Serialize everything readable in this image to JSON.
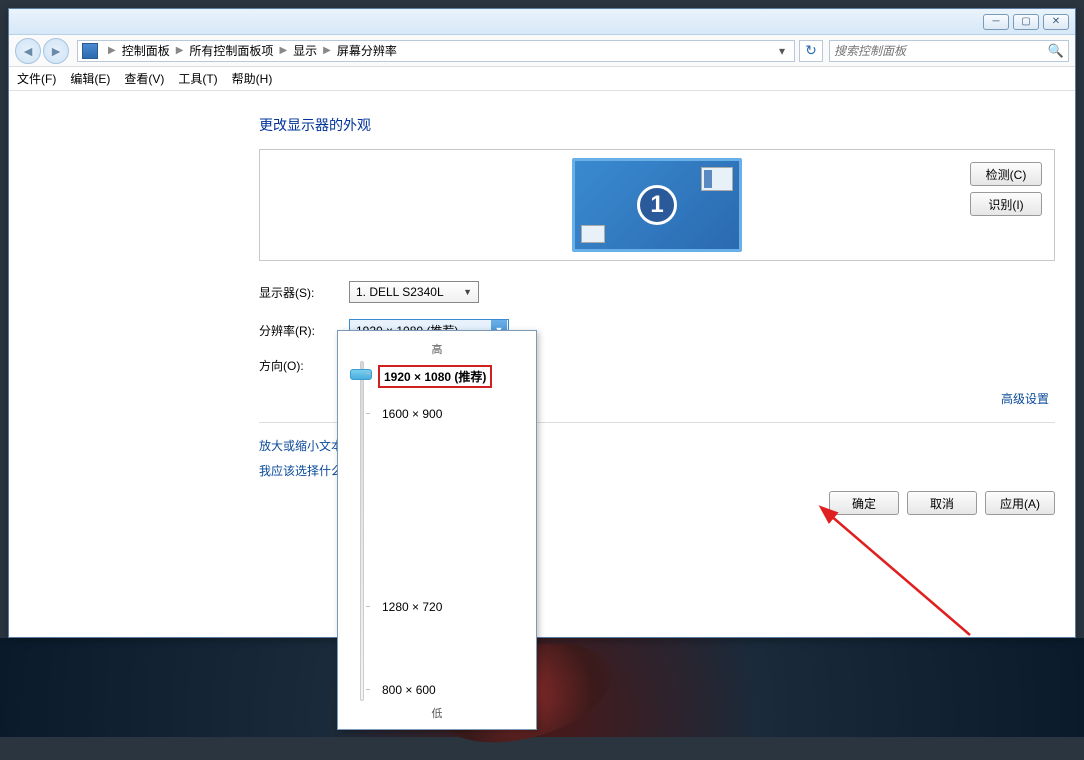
{
  "titlebar": {
    "min": "─",
    "max": "▢",
    "close": "✕"
  },
  "breadcrumb": {
    "cp": "控制面板",
    "all": "所有控制面板项",
    "disp": "显示",
    "res": "屏幕分辨率"
  },
  "search": {
    "placeholder": "搜索控制面板"
  },
  "menu": {
    "file": "文件(F)",
    "edit": "编辑(E)",
    "view": "查看(V)",
    "tools": "工具(T)",
    "help": "帮助(H)"
  },
  "heading": "更改显示器的外观",
  "monitor_num": "1",
  "detect_btn": "检测(C)",
  "identify_btn": "识别(I)",
  "labels": {
    "monitor": "显示器(S):",
    "resolution": "分辨率(R):",
    "orientation": "方向(O):"
  },
  "monitor_value": "1. DELL S2340L",
  "resolution_value": "1920 × 1080 (推荐)",
  "adv_link": "高级设置",
  "link_zoom": "放大或缩小文本",
  "link_which": "我应该选择什么",
  "ok_btn": "确定",
  "cancel_btn": "取消",
  "apply_btn": "应用(A)",
  "slider": {
    "high": "高",
    "low": "低"
  },
  "resolutions": {
    "r0": "1920 × 1080 (推荐)",
    "r1": "1600 × 900",
    "r2": "1280 × 720",
    "r3": "800 × 600"
  }
}
